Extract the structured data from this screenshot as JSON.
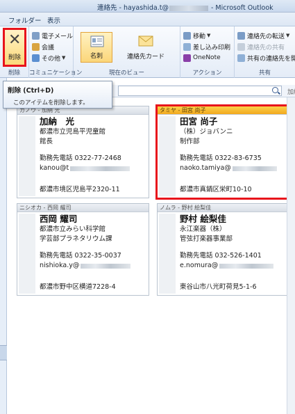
{
  "window": {
    "title_prefix": "連絡先 - hayashida.t@",
    "title_suffix": " - Microsoft Outlook"
  },
  "tabs": [
    "フォルダー",
    "表示"
  ],
  "ribbon": {
    "delete_group": {
      "label": "削除",
      "delete_button": "削除"
    },
    "communication_group": {
      "label": "コミュニケーション",
      "email": "電子メール",
      "meeting": "会議",
      "other": "その他"
    },
    "view_group": {
      "label": "現在のビュー",
      "business_card": "名刺",
      "contact_card": "連絡先カード"
    },
    "action_group": {
      "label": "アクション",
      "move": "移動",
      "mail_merge": "差し込み印刷",
      "onenote": "OneNote"
    },
    "share_group": {
      "label": "共有",
      "forward": "連絡先の転送",
      "share_contacts": "連絡先の共有",
      "open_shared": "共有の連絡先を開"
    }
  },
  "tooltip": {
    "title": "削除 (Ctrl+D)",
    "description": "このアイテムを削除します。"
  },
  "search": {
    "more": "加納"
  },
  "cards": [
    {
      "header": "カノウ - 加納 光",
      "name": "加納　光",
      "company": "都濃市立児島平児童館",
      "department": "館長",
      "phone": "勤務先電話 0322-77-2468",
      "email_prefix": "kanou@t",
      "address": "都濃市境区児島平2320-11"
    },
    {
      "header": "タミヤ - 田宮 尚子",
      "name": "田宮 尚子",
      "company": "（株）ジョバンニ",
      "department": "制作部",
      "phone": "勤務先電話 0322-83-6735",
      "email_prefix": "naoko.tamiya@",
      "address": "都濃市真鍋区栄町10-10"
    },
    {
      "header": "ニシオカ - 西岡 耀司",
      "name": "西岡 耀司",
      "company": "都濃市立みらい科学館",
      "department": "学芸部プラネタリウム課",
      "phone": "勤務先電話 0322-35-0037",
      "email_prefix": "nishioka.y@",
      "address": "都濃市野中区横道7228-4"
    },
    {
      "header": "ノムラ - 野村 絵梨佳",
      "name": "野村 絵梨佳",
      "company": "永江楽器（株）",
      "department": "管弦打楽器事業部",
      "phone": "勤務先電話 032-526-1401",
      "email_prefix": "e.nomura@",
      "address": "東谷山市八光町荷見5-1-6"
    }
  ]
}
